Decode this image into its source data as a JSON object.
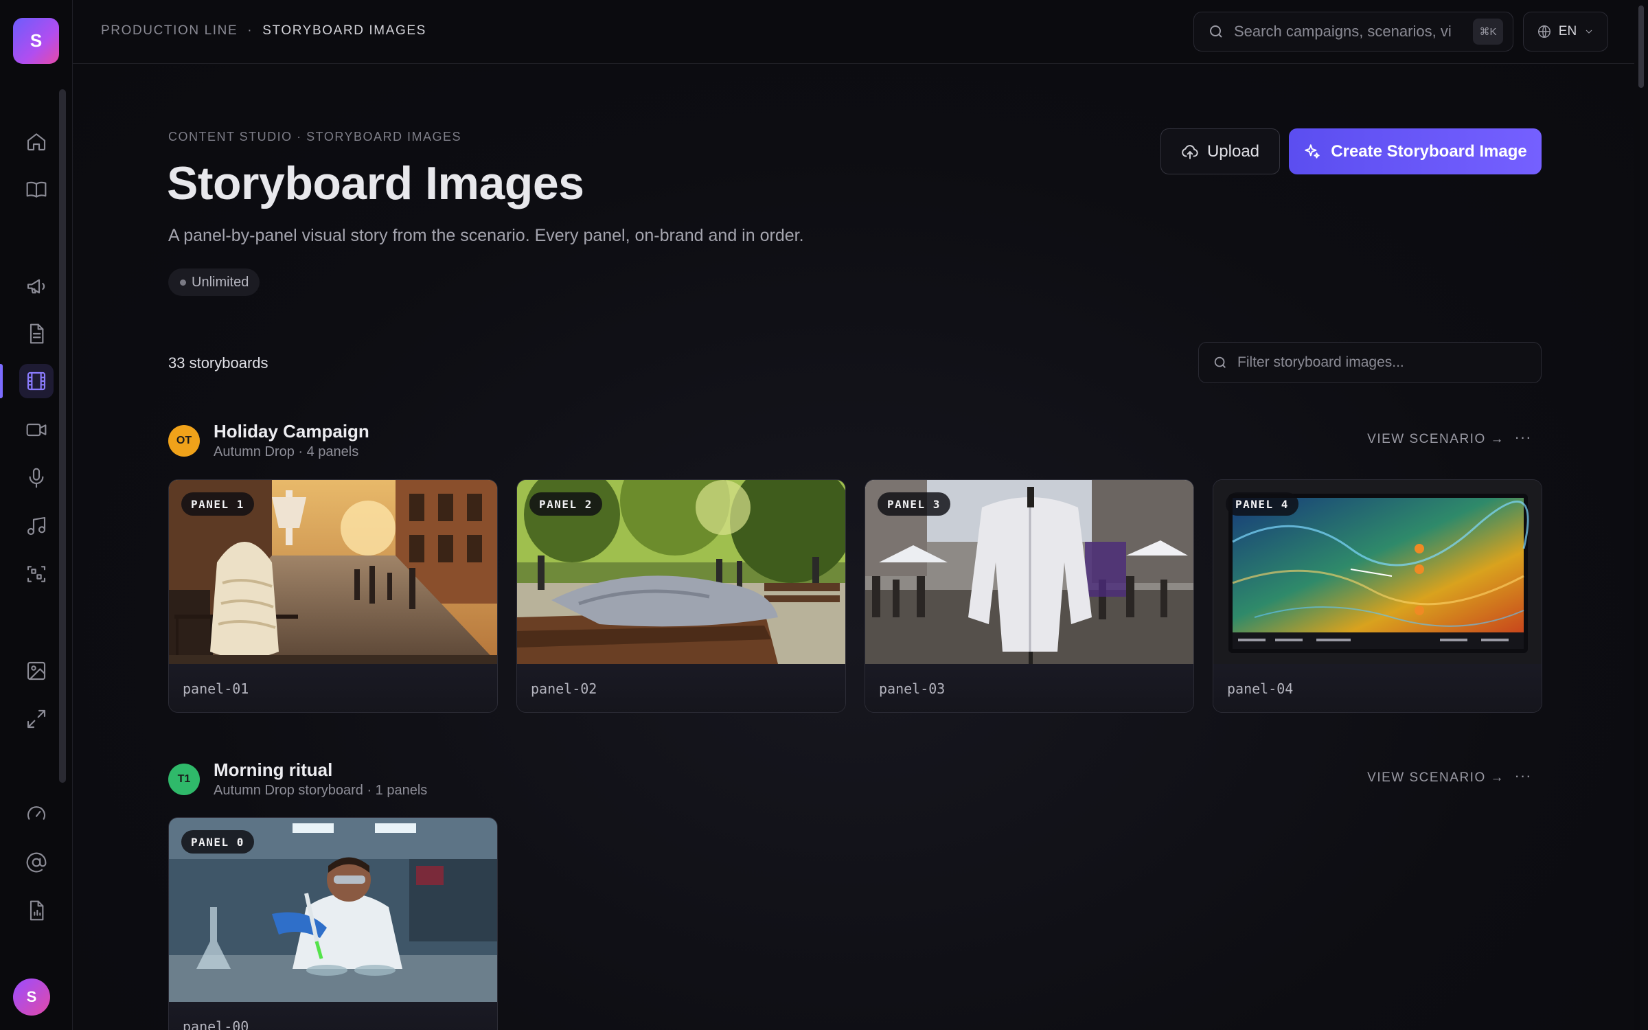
{
  "app": {
    "logo_letter": "S",
    "user_initial": "S"
  },
  "topbar": {
    "crumb_1": "PRODUCTION LINE",
    "crumb_sep": "·",
    "crumb_2": "STORYBOARD IMAGES",
    "search_placeholder": "Search campaigns, scenarios, vi",
    "search_shortcut": "⌘K",
    "language": "EN"
  },
  "header": {
    "kicker": "CONTENT STUDIO · STORYBOARD IMAGES",
    "title": "Storyboard Images",
    "subtitle": "A panel-by-panel visual story from the scenario. Every panel, on-brand and in order.",
    "plan_badge": "Unlimited",
    "upload_label": "Upload",
    "create_label": "Create Storyboard Image"
  },
  "list": {
    "count_label": "33 storyboards",
    "filter_placeholder": "Filter storyboard images..."
  },
  "groups": [
    {
      "badge": "OT",
      "badge_color": "#f0a21a",
      "title": "Holiday Campaign",
      "subtitle": "Autumn Drop · 4 panels",
      "view_label": "VIEW SCENARIO →",
      "more": "···",
      "panels": [
        {
          "tag": "PANEL 1",
          "name": "panel-01",
          "scene": "cafe street jacket"
        },
        {
          "tag": "PANEL 2",
          "name": "panel-02",
          "scene": "park bench jacket"
        },
        {
          "tag": "PANEL 3",
          "name": "panel-03",
          "scene": "market mannequin jacket"
        },
        {
          "tag": "PANEL 4",
          "name": "panel-04",
          "scene": "topographic map screen"
        }
      ]
    },
    {
      "badge": "T1",
      "badge_color": "#2fb96a",
      "title": "Morning ritual",
      "subtitle": "Autumn Drop storyboard · 1 panels",
      "view_label": "VIEW SCENARIO →",
      "more": "···",
      "panels": [
        {
          "tag": "PANEL 0",
          "name": "panel-00",
          "scene": "lab scientist pipette"
        }
      ]
    }
  ],
  "colors": {
    "accent": "#6d5dfc",
    "background": "#0c0c10"
  },
  "icons": [
    "home-icon",
    "book-icon",
    "megaphone-icon",
    "document-icon",
    "film-icon",
    "video-icon",
    "microphone-icon",
    "music-icon",
    "scan-icon",
    "image-icon",
    "expand-icon",
    "gauge-icon",
    "at-icon",
    "report-icon",
    "search-icon",
    "globe-icon",
    "chevron-down-icon",
    "upload-icon",
    "sparkles-icon"
  ]
}
